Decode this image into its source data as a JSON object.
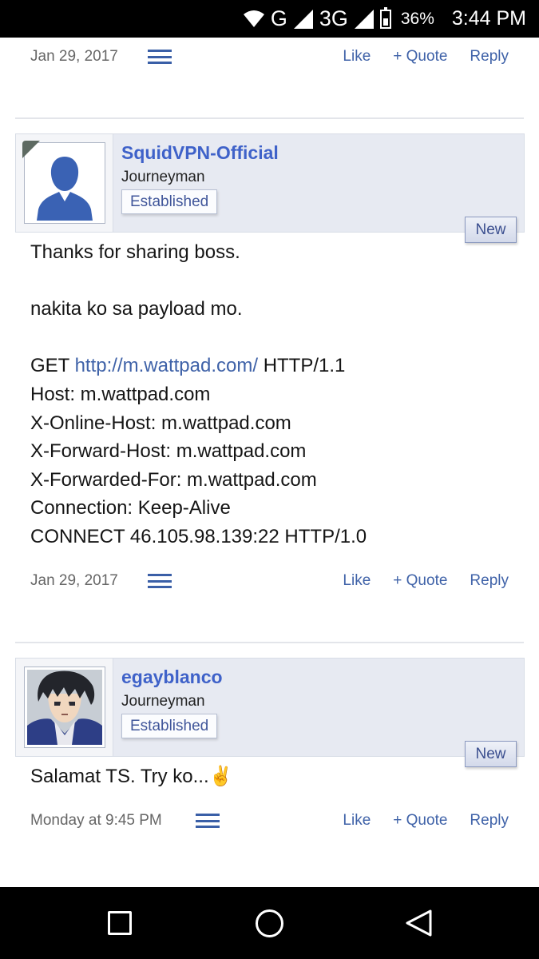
{
  "status_bar": {
    "network": "G",
    "network2": "3G",
    "battery": "36%",
    "time": "3:44 PM"
  },
  "actions": {
    "like": "Like",
    "quote": "+ Quote",
    "reply": "Reply"
  },
  "post0": {
    "date": "Jan 29, 2017"
  },
  "post1": {
    "username": "SquidVPN-Official",
    "title": "Journeyman",
    "badge": "Established",
    "new_label": "New",
    "line1": "Thanks for sharing boss.",
    "line2": "nakita ko sa payload mo.",
    "get": "GET",
    "link": "http://m.wattpad.com/",
    "http": "HTTP/1.1",
    "host": "Host: m.wattpad.com",
    "online_host": "X-Online-Host: m.wattpad.com",
    "forward_host": "X-Forward-Host: m.wattpad.com",
    "forwarded_for": "X-Forwarded-For: m.wattpad.com",
    "connection": "Connection: Keep-Alive",
    "connect": "CONNECT 46.105.98.139:22 HTTP/1.0",
    "date": "Jan 29, 2017"
  },
  "post2": {
    "username": "egayblanco",
    "title": "Journeyman",
    "badge": "Established",
    "new_label": "New",
    "line1": "Salamat TS. Try ko...✌",
    "date": "Monday at 9:45 PM"
  }
}
